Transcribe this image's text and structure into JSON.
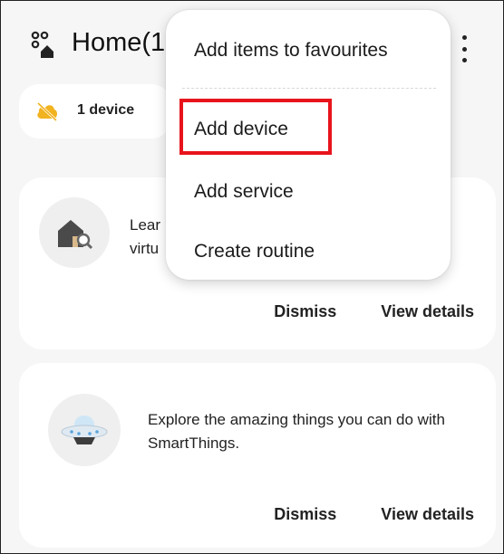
{
  "header": {
    "title": "Home(1",
    "icon": "location-hub-icon"
  },
  "chip": {
    "label": "1 device",
    "icon": "cloud-off-icon",
    "icon_color": "#f2b321"
  },
  "cards": [
    {
      "text_line1": "Lear",
      "text_line2": "virtu",
      "icon": "home-search-icon",
      "dismiss_label": "Dismiss",
      "details_label": "View details"
    },
    {
      "text": "Explore the amazing things you can do with SmartThings.",
      "icon": "ufo-icon",
      "dismiss_label": "Dismiss",
      "details_label": "View details"
    }
  ],
  "menu": {
    "items": [
      {
        "label": "Add items to favourites"
      },
      {
        "label": "Add device"
      },
      {
        "label": "Add service"
      },
      {
        "label": "Create routine"
      }
    ],
    "highlight_color": "#e8141c"
  },
  "more_options_icon": "more-vertical-icon"
}
